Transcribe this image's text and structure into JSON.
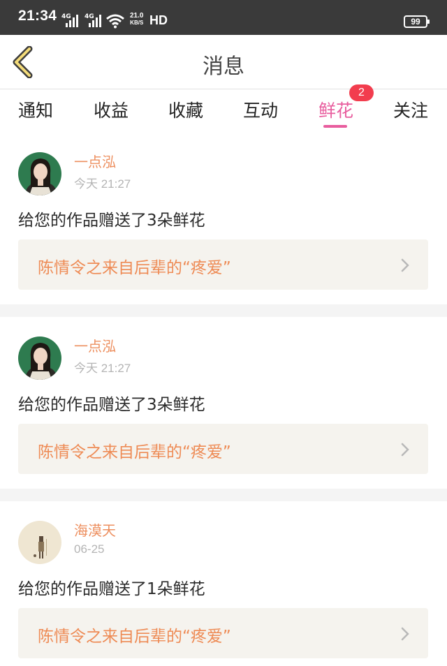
{
  "status_bar": {
    "time": "21:34",
    "network_1": "4G",
    "network_2": "4G",
    "speed_value": "21.0",
    "speed_unit": "KB/S",
    "hd": "HD",
    "battery": "99"
  },
  "header": {
    "title": "消息",
    "back_icon": "chevron-left-icon"
  },
  "tabs": [
    {
      "label": "通知",
      "active": false
    },
    {
      "label": "收益",
      "active": false
    },
    {
      "label": "收藏",
      "active": false
    },
    {
      "label": "互动",
      "active": false
    },
    {
      "label": "鲜花",
      "active": true,
      "badge": "2"
    },
    {
      "label": "关注",
      "active": false
    }
  ],
  "messages": [
    {
      "user": "一点泓",
      "time": "今天 21:27",
      "text": "给您的作品赠送了3朵鲜花",
      "work_title": "陈情令之来自后辈的“疼爱”"
    },
    {
      "user": "一点泓",
      "time": "今天 21:27",
      "text": "给您的作品赠送了3朵鲜花",
      "work_title": "陈情令之来自后辈的“疼爱”"
    },
    {
      "user": "海漠天",
      "time": "06-25",
      "text": "给您的作品赠送了1朵鲜花",
      "work_title": "陈情令之来自后辈的“疼爱”"
    }
  ],
  "colors": {
    "accent_pink": "#e85d9e",
    "name_orange": "#ed8f5f",
    "badge_red": "#f23d4e",
    "link_bg": "#f5f3ee"
  }
}
